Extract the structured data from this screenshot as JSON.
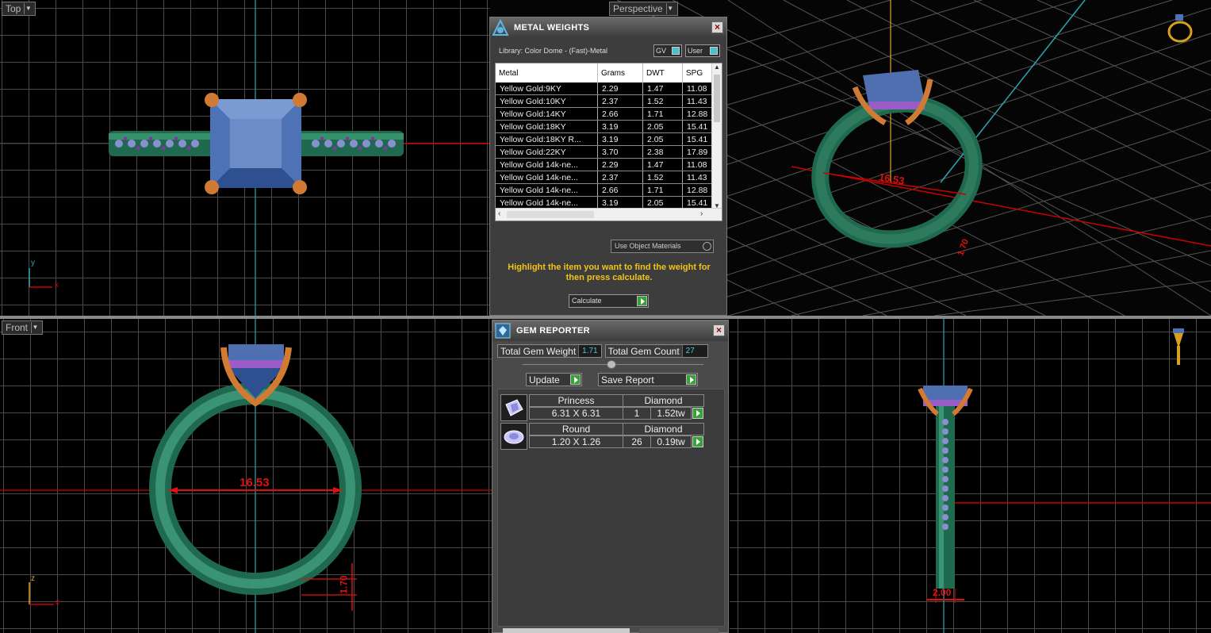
{
  "viewports": {
    "top": {
      "label": "Top"
    },
    "perspective": {
      "label": "Perspective"
    },
    "front": {
      "label": "Front"
    },
    "axes": {
      "x": "x",
      "y": "y",
      "z": "z"
    },
    "dimensions": {
      "front_diameter": "16.53",
      "front_thickness": "1.70",
      "perspective_diameter": "16.53",
      "perspective_small": "1.70",
      "side_width": "2.00"
    }
  },
  "metal_weights": {
    "title": "METAL WEIGHTS",
    "library": "Library: Color Dome - (Fast)-Metal",
    "toggle_gv": "GV",
    "toggle_user": "User",
    "columns": [
      "Metal",
      "Grams",
      "DWT",
      "SPG"
    ],
    "rows": [
      [
        "Yellow Gold:9KY",
        "2.29",
        "1.47",
        "11.08"
      ],
      [
        "Yellow Gold:10KY",
        "2.37",
        "1.52",
        "11.43"
      ],
      [
        "Yellow Gold:14KY",
        "2.66",
        "1.71",
        "12.88"
      ],
      [
        "Yellow Gold:18KY",
        "3.19",
        "2.05",
        "15.41"
      ],
      [
        "Yellow Gold:18KY R...",
        "3.19",
        "2.05",
        "15.41"
      ],
      [
        "Yellow Gold:22KY",
        "3.70",
        "2.38",
        "17.89"
      ],
      [
        "Yellow Gold 14k-ne...",
        "2.29",
        "1.47",
        "11.08"
      ],
      [
        "Yellow Gold 14k-ne...",
        "2.37",
        "1.52",
        "11.43"
      ],
      [
        "Yellow Gold 14k-ne...",
        "2.66",
        "1.71",
        "12.88"
      ],
      [
        "Yellow Gold 14k-ne...",
        "3.19",
        "2.05",
        "15.41"
      ],
      [
        "Yellow Gold 14k-ne...",
        "3.19",
        "2.05",
        "15.41"
      ]
    ],
    "use_object_materials": "Use Object Materials",
    "hint": "Highlight the item you want to find the weight for then press calculate.",
    "calculate": "Calculate"
  },
  "gem_reporter": {
    "title": "GEM REPORTER",
    "total_weight_label": "Total Gem Weight",
    "total_weight": "1.71",
    "total_count_label": "Total Gem Count",
    "total_count": "27",
    "update": "Update",
    "save_report": "Save Report",
    "gems": [
      {
        "shape": "Princess",
        "type": "Diamond",
        "size": "6.31 X 6.31",
        "qty": "1",
        "weight": "1.52tw",
        "icon": "princess-gem-icon"
      },
      {
        "shape": "Round",
        "type": "Diamond",
        "size": "1.20 X 1.26",
        "qty": "26",
        "weight": "0.19tw",
        "icon": "round-gem-icon"
      }
    ]
  },
  "colors": {
    "band": "#2e7a5e",
    "prong": "#d07a33",
    "stone": "#5577bb",
    "dimension": "#e01010",
    "hint": "#f2c318"
  }
}
